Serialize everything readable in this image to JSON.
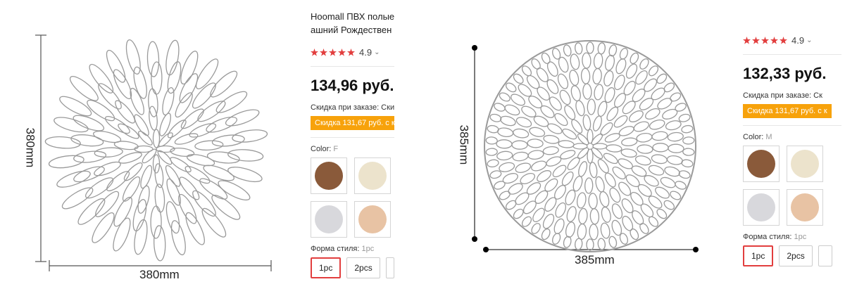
{
  "colors": {
    "star": "#e23e3e",
    "discount_badge": "#f7a20b",
    "selected_border": "#e23e3e",
    "silver": "#9a9a9a"
  },
  "left": {
    "dimensions": {
      "width_label": "380mm",
      "height_label": "380mm"
    },
    "product": {
      "title_line1": "Hoomall ПВХ полые",
      "title_line2": "ашний Рождествен",
      "rating": "4.9",
      "price": "134,96 руб.",
      "discount_text": "Скидка при заказе: Ски",
      "discount_badge": "Скидка 131,67 руб. с к",
      "color_label": "Color:",
      "color_value": "F",
      "swatches": [
        {
          "name": "brown",
          "color": "#8a5a3a"
        },
        {
          "name": "cream",
          "color": "#ece3cc"
        },
        {
          "name": "silver",
          "color": "#d8d8dc"
        },
        {
          "name": "rose-gold",
          "color": "#e8c3a4"
        }
      ],
      "style_label": "Форма стиля:",
      "style_value": "1pc",
      "style_options": [
        "1pc",
        "2pcs"
      ]
    }
  },
  "right": {
    "dimensions": {
      "width_label": "385mm",
      "height_label": "385mm"
    },
    "product": {
      "rating": "4.9",
      "price": "132,33 руб.",
      "discount_text": "Скидка при заказе: Ск",
      "discount_badge": "Скидка 131,67 руб. с к",
      "color_label": "Color:",
      "color_value": "M",
      "swatches": [
        {
          "name": "brown",
          "color": "#8a5a3a"
        },
        {
          "name": "cream",
          "color": "#ece3cc"
        },
        {
          "name": "silver",
          "color": "#d8d8dc"
        },
        {
          "name": "rose-gold",
          "color": "#e8c3a4"
        }
      ],
      "style_label": "Форма стиля:",
      "style_value": "1pc",
      "style_options": [
        "1pc",
        "2pcs"
      ]
    }
  }
}
